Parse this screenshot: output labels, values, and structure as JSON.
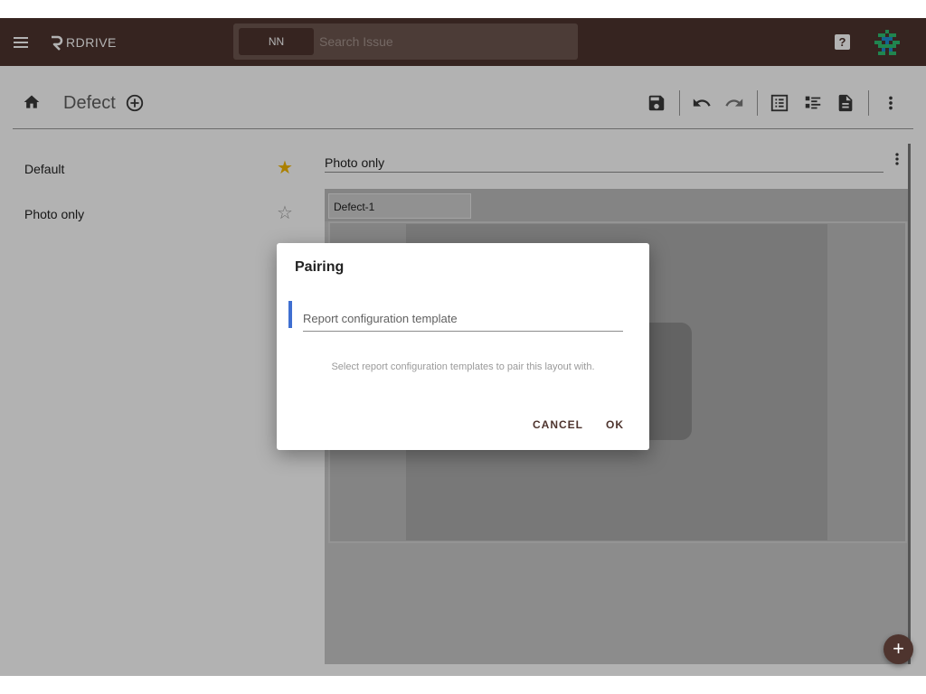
{
  "app": {
    "logo_text": "RDRIVE"
  },
  "search": {
    "scope_chip": "NN",
    "placeholder": "Search Issue"
  },
  "toolbar": {
    "title": "Defect"
  },
  "layouts": [
    {
      "label": "Default",
      "starred": true
    },
    {
      "label": "Photo only",
      "starred": false
    }
  ],
  "editor": {
    "layout_name": "Photo only",
    "tab_label": "Defect-1"
  },
  "dialog": {
    "title": "Pairing",
    "field_placeholder": "Report configuration template",
    "hint": "Select report configuration templates to pair this layout with.",
    "cancel_label": "CANCEL",
    "ok_label": "OK"
  },
  "icons": {
    "menu": "menu-icon",
    "home": "home-icon",
    "add_circle": "add-circle-icon",
    "save": "save-icon",
    "undo": "undo-icon",
    "redo": "redo-icon",
    "list": "list-view-icon",
    "detail": "detail-view-icon",
    "document": "document-icon",
    "more": "more-vert-icon",
    "help": "help-icon",
    "fab": "add-icon"
  },
  "colors": {
    "brand": "#4e342e",
    "accent": "#3f6fd1",
    "star": "#f5b800"
  },
  "fab_label": "+"
}
